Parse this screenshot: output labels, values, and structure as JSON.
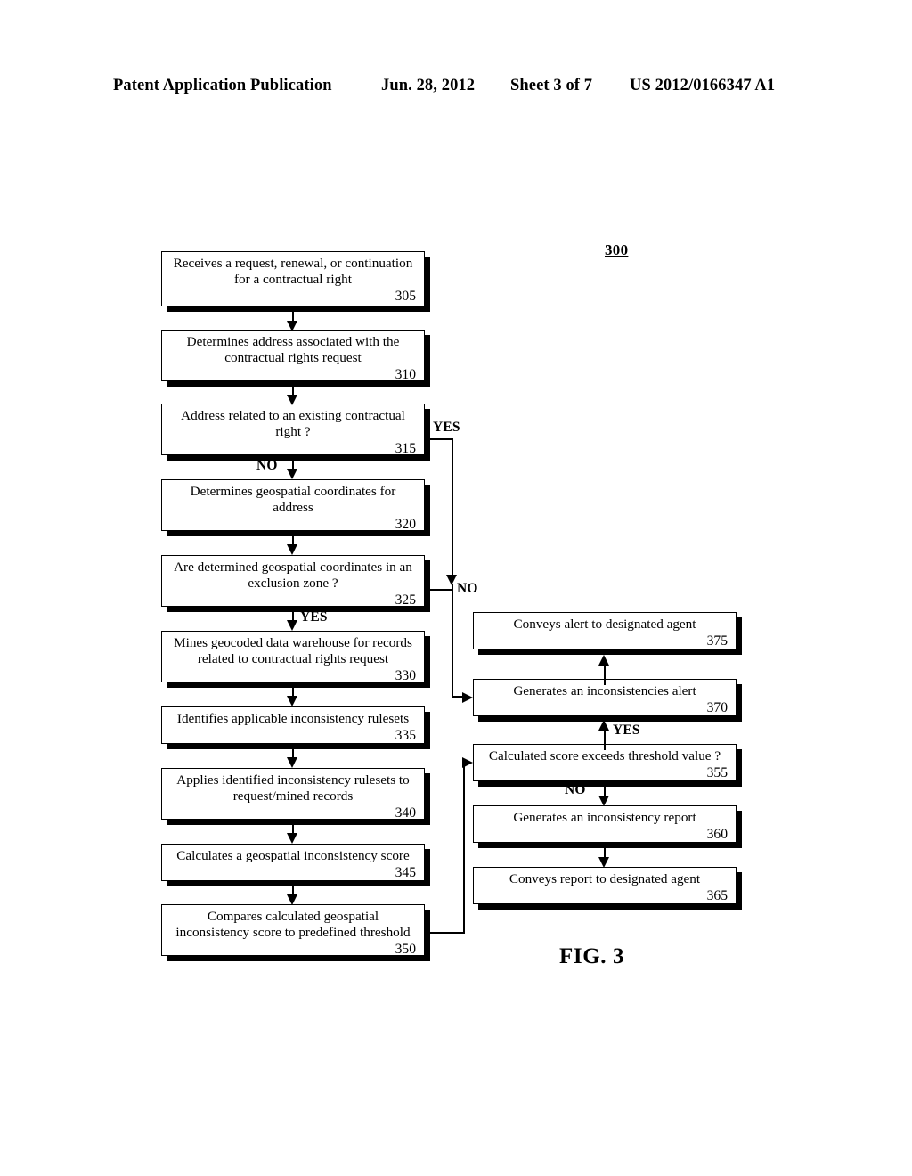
{
  "header": {
    "publication": "Patent Application Publication",
    "date": "Jun. 28, 2012",
    "sheet": "Sheet 3 of 7",
    "patent_number": "US 2012/0166347 A1"
  },
  "figure": {
    "caption": "FIG. 3",
    "reference_numeral": "300"
  },
  "flowchart": {
    "type": "flowchart",
    "nodes": [
      {
        "id": "305",
        "text": "Receives a request, renewal, or continuation\nfor a contractual right",
        "number": "305",
        "shape": "process"
      },
      {
        "id": "310",
        "text": "Determines address associated with the\ncontractual rights request",
        "number": "310",
        "shape": "process"
      },
      {
        "id": "315",
        "text": "Address related to an existing contractual\nright ?",
        "number": "315",
        "shape": "decision"
      },
      {
        "id": "320",
        "text": "Determines geospatial coordinates for\naddress",
        "number": "320",
        "shape": "process"
      },
      {
        "id": "325",
        "text": "Are determined geospatial coordinates in an\nexclusion zone ?",
        "number": "325",
        "shape": "decision"
      },
      {
        "id": "330",
        "text": "Mines geocoded data warehouse for records\nrelated to contractual rights request",
        "number": "330",
        "shape": "process"
      },
      {
        "id": "335",
        "text": "Identifies applicable inconsistency rulesets",
        "number": "335",
        "shape": "process"
      },
      {
        "id": "340",
        "text": "Applies identified inconsistency rulesets to\nrequest/mined records",
        "number": "340",
        "shape": "process"
      },
      {
        "id": "345",
        "text": "Calculates a geospatial inconsistency score",
        "number": "345",
        "shape": "process"
      },
      {
        "id": "350",
        "text": "Compares calculated geospatial\ninconsistency score to predefined threshold",
        "number": "350",
        "shape": "process"
      },
      {
        "id": "355",
        "text": "Calculated score exceeds threshold value ?",
        "number": "355",
        "shape": "decision"
      },
      {
        "id": "360",
        "text": "Generates an inconsistency report",
        "number": "360",
        "shape": "process"
      },
      {
        "id": "365",
        "text": "Conveys report to designated agent",
        "number": "365",
        "shape": "process"
      },
      {
        "id": "370",
        "text": "Generates an inconsistencies alert",
        "number": "370",
        "shape": "process"
      },
      {
        "id": "375",
        "text": "Conveys alert to designated agent",
        "number": "375",
        "shape": "process"
      }
    ],
    "edges": [
      {
        "from": "305",
        "to": "310",
        "label": ""
      },
      {
        "from": "310",
        "to": "315",
        "label": ""
      },
      {
        "from": "315",
        "to": "320",
        "label": "NO"
      },
      {
        "from": "315",
        "to": "370",
        "label": "YES"
      },
      {
        "from": "320",
        "to": "325",
        "label": ""
      },
      {
        "from": "325",
        "to": "330",
        "label": "YES"
      },
      {
        "from": "325",
        "to": "370",
        "label": "NO"
      },
      {
        "from": "330",
        "to": "335",
        "label": ""
      },
      {
        "from": "335",
        "to": "340",
        "label": ""
      },
      {
        "from": "340",
        "to": "345",
        "label": ""
      },
      {
        "from": "345",
        "to": "350",
        "label": ""
      },
      {
        "from": "350",
        "to": "355",
        "label": ""
      },
      {
        "from": "355",
        "to": "370",
        "label": "YES"
      },
      {
        "from": "355",
        "to": "360",
        "label": "NO"
      },
      {
        "from": "360",
        "to": "365",
        "label": ""
      },
      {
        "from": "370",
        "to": "375",
        "label": ""
      }
    ],
    "branch_labels": {
      "yes_315": "YES",
      "no_315": "NO",
      "no_325": "NO",
      "yes_325": "YES",
      "yes_355": "YES",
      "no_355": "NO"
    }
  }
}
